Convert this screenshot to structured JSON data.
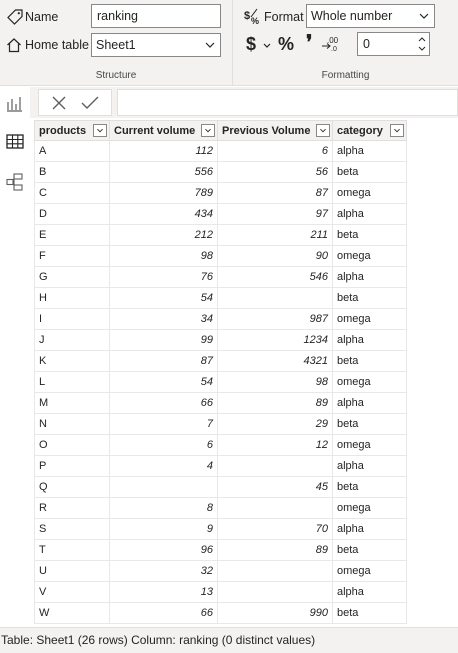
{
  "ribbon": {
    "structure": {
      "name_label": "Name",
      "name_value": "ranking",
      "home_table_label": "Home table",
      "home_table_value": "Sheet1",
      "section_label": "Structure"
    },
    "formatting": {
      "format_label": "Format",
      "format_value": "Whole number",
      "currency_symbol": "$",
      "percent_symbol": "%",
      "comma_symbol": "❜",
      "decimal_value": "0",
      "section_label": "Formatting"
    }
  },
  "table": {
    "columns": [
      "products",
      "Current volume",
      "Previous Volume",
      "category"
    ],
    "rows": [
      [
        "A",
        "112",
        "6",
        "alpha"
      ],
      [
        "B",
        "556",
        "56",
        "beta"
      ],
      [
        "C",
        "789",
        "87",
        "omega"
      ],
      [
        "D",
        "434",
        "97",
        "alpha"
      ],
      [
        "E",
        "212",
        "211",
        "beta"
      ],
      [
        "F",
        "98",
        "90",
        "omega"
      ],
      [
        "G",
        "76",
        "546",
        "alpha"
      ],
      [
        "H",
        "54",
        "",
        "beta"
      ],
      [
        "I",
        "34",
        "987",
        "omega"
      ],
      [
        "J",
        "99",
        "1234",
        "alpha"
      ],
      [
        "K",
        "87",
        "4321",
        "beta"
      ],
      [
        "L",
        "54",
        "98",
        "omega"
      ],
      [
        "M",
        "66",
        "89",
        "alpha"
      ],
      [
        "N",
        "7",
        "29",
        "beta"
      ],
      [
        "O",
        "6",
        "12",
        "omega"
      ],
      [
        "P",
        "4",
        "",
        "alpha"
      ],
      [
        "Q",
        "",
        "45",
        "beta"
      ],
      [
        "R",
        "8",
        "",
        "omega"
      ],
      [
        "S",
        "9",
        "70",
        "alpha"
      ],
      [
        "T",
        "96",
        "89",
        "beta"
      ],
      [
        "U",
        "32",
        "",
        "omega"
      ],
      [
        "V",
        "13",
        "",
        "alpha"
      ],
      [
        "W",
        "66",
        "990",
        "beta"
      ]
    ]
  },
  "status_bar": {
    "text": "Table: Sheet1 (26 rows) Column: ranking (0 distinct values)"
  },
  "icons": {
    "name": "tag-icon",
    "home_table": "home-icon",
    "format": "format-dollar-icon",
    "decimals": "decimal-places-icon",
    "cancel": "close-icon",
    "commit": "checkmark-icon",
    "report_view": "report-view-icon",
    "data_view": "data-view-icon",
    "model_view": "model-view-icon"
  }
}
